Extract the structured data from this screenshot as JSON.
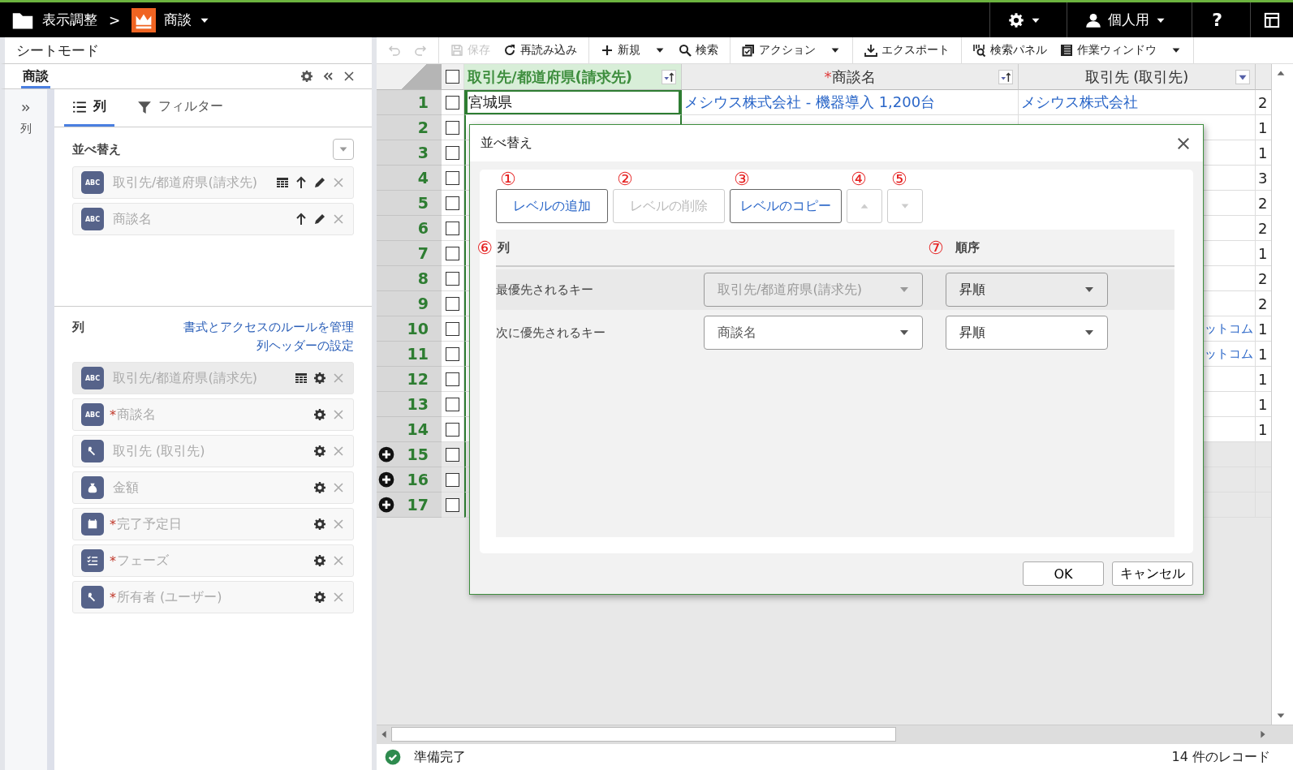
{
  "topbar": {
    "crumbs": [
      {
        "kind": "folder",
        "label": "表示調整"
      },
      {
        "kind": "crown",
        "label": "商談"
      }
    ],
    "separator": ">",
    "user": "個人用",
    "help": "?"
  },
  "left_panel": {
    "title": "シートモード",
    "tab": "商談",
    "rail_label": "列",
    "tabs": [
      {
        "kind": "list",
        "label": "列",
        "selected": true
      },
      {
        "kind": "filter",
        "label": "フィルター",
        "selected": false
      }
    ],
    "sort": {
      "title": "並べ替え",
      "items": [
        {
          "kind": "text",
          "badge": "ABC",
          "label": "取引先/都道府県(請求先)",
          "grouped": true
        },
        {
          "kind": "text",
          "badge": "ABC",
          "label": "商談名",
          "grouped": false
        }
      ]
    },
    "columns": {
      "title": "列",
      "links": [
        "書式とアクセスのルールを管理",
        "列ヘッダーの設定"
      ],
      "items": [
        {
          "kind": "text",
          "badge": "ABC",
          "label": "取引先/都道府県(請求先)",
          "selected": true,
          "grouped": true
        },
        {
          "kind": "text",
          "badge": "ABC",
          "mark": "*",
          "label": "商談名",
          "selected": false,
          "grouped": false
        },
        {
          "kind": "lookup",
          "label": "取引先 (取引先)",
          "selected": false,
          "grouped": false
        },
        {
          "kind": "money",
          "label": "金額",
          "selected": false,
          "grouped": false
        },
        {
          "kind": "calendar",
          "mark": "*",
          "label": "完了予定日",
          "selected": false,
          "grouped": false
        },
        {
          "kind": "checklist",
          "mark": "*",
          "label": "フェーズ",
          "selected": false,
          "grouped": false
        },
        {
          "kind": "lookup",
          "mark": "*",
          "label": "所有者 (ユーザー)",
          "selected": false,
          "grouped": false
        }
      ]
    }
  },
  "toolbar": [
    [
      {
        "kind": "undo",
        "disabled": true
      },
      {
        "kind": "redo",
        "disabled": true
      }
    ],
    [
      {
        "kind": "save",
        "label": "保存",
        "disabled": true
      },
      {
        "kind": "reload",
        "label": "再読み込み",
        "disabled": false
      }
    ],
    [
      {
        "kind": "plus",
        "label": "新規",
        "disabled": false,
        "dropdown": true
      },
      {
        "kind": "search",
        "label": "検索",
        "disabled": false
      }
    ],
    [
      {
        "kind": "action",
        "label": "アクション",
        "disabled": false,
        "dropdown": true
      }
    ],
    [
      {
        "kind": "download",
        "label": "エクスポート",
        "disabled": false
      }
    ],
    [
      {
        "kind": "panel",
        "label": "検索パネル",
        "disabled": false
      },
      {
        "kind": "window",
        "label": "作業ウィンドウ",
        "disabled": false,
        "dropdown": true
      }
    ]
  ],
  "grid": {
    "select_all": {
      "checked": false
    },
    "columns": [
      {
        "label": "取引先/都道府県(請求先)",
        "selected": true,
        "kind": "sort"
      },
      {
        "mark": "*",
        "label": "商談名",
        "selected": false,
        "kind": "sort"
      },
      {
        "label": "取引先 (取引先)",
        "selected": false,
        "kind": "filter"
      }
    ],
    "rows": [
      {
        "number": "1",
        "new": false,
        "checked": false,
        "cells": [
          "宮城県",
          "メシウス株式会社 - 機器導入 1,200台",
          "メシウス株式会社",
          "2"
        ]
      },
      {
        "number": "2",
        "new": false,
        "checked": false,
        "cells": [
          "",
          "",
          "",
          "1"
        ]
      },
      {
        "number": "3",
        "new": false,
        "checked": false,
        "cells": [
          "",
          "",
          "",
          "1"
        ]
      },
      {
        "number": "4",
        "new": false,
        "checked": false,
        "cells": [
          "",
          "",
          "",
          "3"
        ]
      },
      {
        "number": "5",
        "new": false,
        "checked": false,
        "cells": [
          "",
          "",
          "",
          "2"
        ]
      },
      {
        "number": "6",
        "new": false,
        "checked": false,
        "cells": [
          "",
          "",
          "",
          "2"
        ]
      },
      {
        "number": "7",
        "new": false,
        "checked": false,
        "cells": [
          "",
          "",
          "",
          "1"
        ]
      },
      {
        "number": "8",
        "new": false,
        "checked": false,
        "cells": [
          "",
          "",
          "",
          "2"
        ]
      },
      {
        "number": "9",
        "new": false,
        "checked": false,
        "cells": [
          "",
          "",
          "",
          "2"
        ]
      },
      {
        "number": "10",
        "new": false,
        "checked": false,
        "cells": [
          "",
          "",
          "ットコム",
          "1"
        ],
        "covered": true
      },
      {
        "number": "11",
        "new": false,
        "checked": false,
        "cells": [
          "",
          "",
          "ットコム",
          "1"
        ],
        "covered": true
      },
      {
        "number": "12",
        "new": false,
        "checked": false,
        "cells": [
          "",
          "",
          "",
          "1"
        ]
      },
      {
        "number": "13",
        "new": false,
        "checked": false,
        "cells": [
          "",
          "",
          "",
          "1"
        ]
      },
      {
        "number": "14",
        "new": false,
        "checked": false,
        "cells": [
          "",
          "",
          "",
          "1"
        ]
      },
      {
        "number": "15",
        "new": true,
        "checked": false,
        "cells": [
          "",
          "",
          "",
          ""
        ]
      },
      {
        "number": "16",
        "new": true,
        "checked": false,
        "cells": [
          "",
          "",
          "",
          ""
        ]
      },
      {
        "number": "17",
        "new": true,
        "checked": false,
        "cells": [
          "",
          "",
          "",
          ""
        ]
      }
    ]
  },
  "dialog": {
    "title": "並べ替え",
    "buttons": [
      {
        "kind": "text",
        "label": "レベルの追加",
        "annotation": "①",
        "disabled": false
      },
      {
        "kind": "text",
        "label": "レベルの削除",
        "annotation": "②",
        "disabled": true
      },
      {
        "kind": "text",
        "label": "レベルのコピー",
        "annotation": "③",
        "disabled": false
      },
      {
        "kind": "up",
        "annotation": "④",
        "disabled": true
      },
      {
        "kind": "down",
        "annotation": "⑤",
        "disabled": true
      }
    ],
    "headers": [
      {
        "label": "列",
        "annotation": "⑥"
      },
      {
        "label": "順序",
        "annotation": "⑦"
      }
    ],
    "levels": [
      {
        "label": "最優先されるキー",
        "key": "取引先/都道府県(請求先)",
        "order": "昇順",
        "selected": true
      },
      {
        "label": "次に優先されるキー",
        "key": "商談名",
        "order": "昇順",
        "selected": false
      }
    ],
    "actions": [
      "OK",
      "キャンセル"
    ]
  },
  "status_bar": {
    "state": "準備完了",
    "count": "14 件のレコード"
  }
}
